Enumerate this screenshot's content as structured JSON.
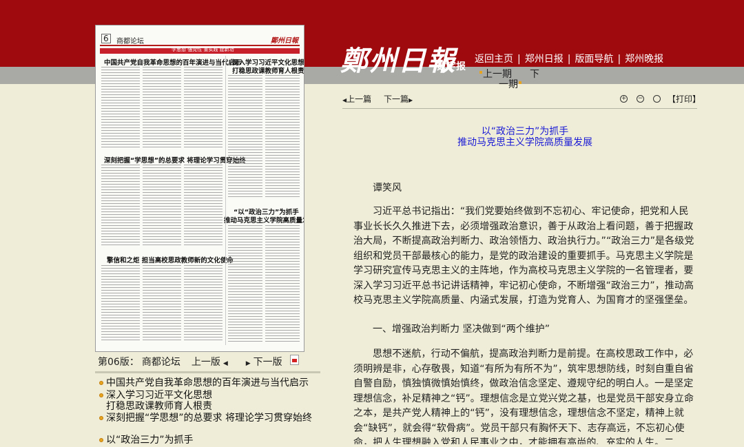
{
  "masthead": {
    "logo": "鄭州日報",
    "logo_sub": "数字报",
    "nav": [
      "返回主页",
      "郑州日报",
      "版面导航",
      "郑州晚报"
    ],
    "period_prev": "上一期",
    "period_next": "下",
    "period_next2": "一期"
  },
  "page_thumb": {
    "page_num": "6",
    "section": "商都论坛",
    "paper_logo": "鄭州日報",
    "strip_text": "学思想 强党性 重实践 建新功",
    "titles": [
      "中国共产党自我革命思想的百年演进与当代启示",
      "深入学习习近平文化思想",
      "打稳思政课教师育人根责",
      "深刻把握“学思想”的总要求 将理论学习贯穿始终",
      "“以“政治三力”为抓手",
      "推动马克思主义学院高质量发展",
      "擎信和之炬 担当高校思政教师新的文化使命"
    ]
  },
  "page_nav": {
    "edition": "第06版：",
    "section": "商都论坛",
    "prev": "上一版",
    "next": "下一版"
  },
  "article_list": [
    "中国共产党自我革命思想的百年演进与当代启示",
    "深入学习习近平文化思想 打稳思政课教师育人根责",
    "深刻把握“学思想”的总要求 将理论学习贯穿始终",
    "以“政治三力”为抓手"
  ],
  "article_toolbar": {
    "prev": "上一篇",
    "next": "下一篇",
    "print": "【打印】",
    "zoom_in": "+",
    "zoom_out": "−",
    "zoom_reset": ""
  },
  "article": {
    "title_line1": "以“政治三力”为抓手",
    "title_line2": "推动马克思主义学院高质量发展",
    "author": "谭笑风",
    "para1": "习近平总书记指出：“我们党要始终做到不忘初心、牢记使命，把党和人民事业长长久久推进下去，必须增强政治意识，善于从政治上看问题，善于把握政治大局，不断提高政治判断力、政治领悟力、政治执行力。”“政治三力”是各级党组织和党员干部最核心的能力，是党的政治建设的重要抓手。马克思主义学院是学习研究宣传马克思主义的主阵地，作为高校马克思主义学院的一名管理者，要深入学习习近平总书记讲话精神，牢记初心使命，不断增强“政治三力”，推动高校马克思主义学院高质量、内涵式发展，打造为党育人、为国育才的坚强堡垒。",
    "heading1": "一、增强政治判断力 坚决做到“两个维护”",
    "para2": "思想不迷航，行动不偏航，提高政治判断力是前提。在高校思政工作中，必须明辨是非，心存敬畏，知道“有所为有所不为”，筑牢思想防线，时刻自重自省自警自励，慎独慎微慎始慎终，做政治信念坚定、遵规守纪的明白人。一是坚定理想信念，补足精神之“钙”。理想信念是立党兴党之基，也是党员干部安身立命之本，是共产党人精神上的“钙”，没有理想信念，理想信念不坚定，精神上就会“缺钙”，就会得“软骨病”。党员干部只有胸怀天下、志存高远，不忘初心使命，把人生理想融入党和人民事业之中，才能拥有高尚的、充实的人生。二是“有"
  }
}
